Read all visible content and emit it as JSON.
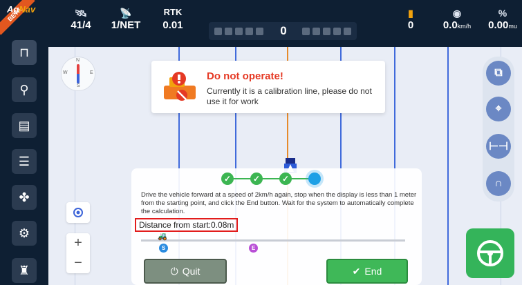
{
  "app": {
    "logo_prefix": "Ag",
    "logo_suffix": "Nav",
    "beta_badge": "BETA"
  },
  "status": {
    "satellites": "41/4",
    "network": "1/NET",
    "rtk_label": "RTK",
    "rtk_value": "0.01",
    "offset": "0",
    "signal_value": "0",
    "speed_value": "0.0",
    "speed_unit": "km/h",
    "rate_value": "0.00",
    "rate_unit": "mu"
  },
  "compass": {
    "n": "N",
    "s": "S",
    "e": "E",
    "w": "W"
  },
  "alert": {
    "title": "Do not operate!",
    "message": "Currently it is a calibration line, please do not use it for work"
  },
  "panel": {
    "instructions": "Drive the vehicle forward at a speed of 2km/h again, stop when the display is less than 1 meter from the starting point, and click the End button. Wait for the system to automatically complete the calculation.",
    "distance": "Distance from start:0.08m",
    "start_marker": "S",
    "end_marker": "E",
    "quit_label": "Quit",
    "end_label": "End"
  },
  "zoom": {
    "in": "+",
    "out": "−"
  },
  "colors": {
    "topbar": "#0e1f33",
    "accent_green": "#3fb858",
    "alert_red": "#e53924",
    "line_blue": "#2d5bd8",
    "guide_orange": "#e68a2b"
  },
  "icons": {
    "sidebar": [
      "implement-icon",
      "field-icon",
      "task-icon",
      "settings-sliders-icon",
      "fan-icon",
      "gear-icon",
      "operator-icon"
    ],
    "right_tools": [
      "layers-icon",
      "map-pin-icon",
      "ab-line-icon",
      "u-turn-icon"
    ]
  }
}
